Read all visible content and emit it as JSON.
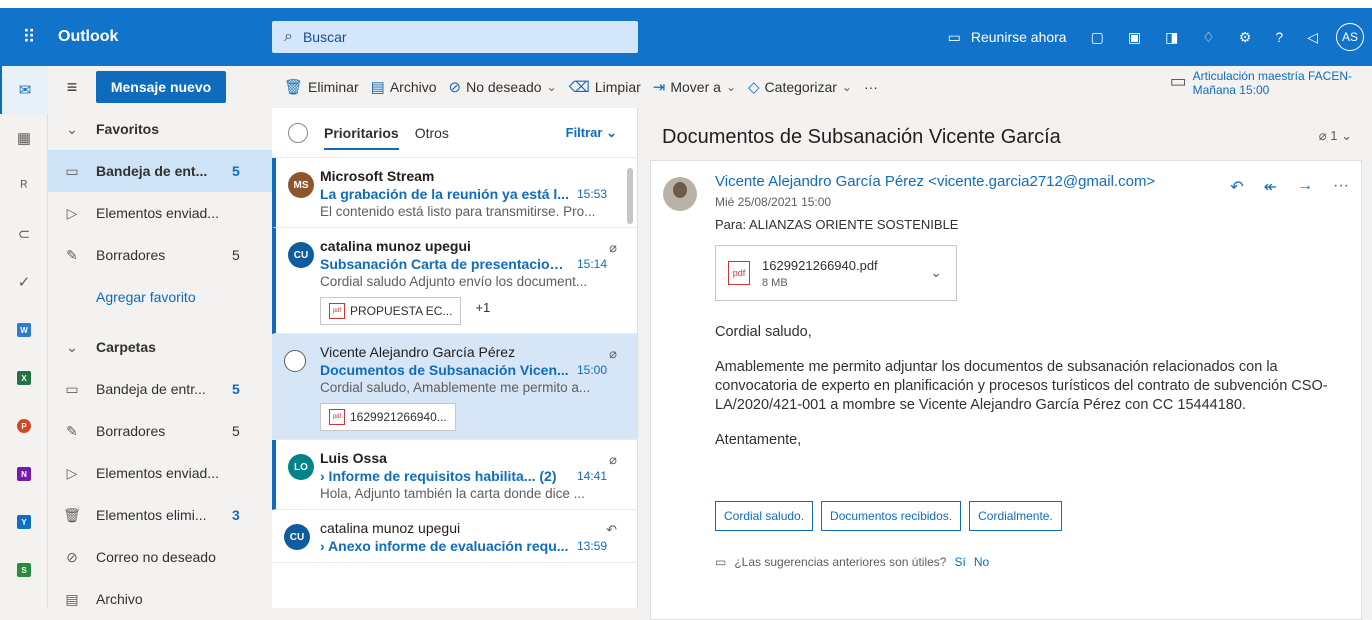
{
  "header": {
    "app_name": "Outlook",
    "search_placeholder": "Buscar",
    "meet_now": "Reunirse ahora",
    "avatar_initials": "AS",
    "help": "?"
  },
  "nav": {
    "new_mail": "Mensaje nuevo",
    "favorites": "Favoritos",
    "favorite_items": [
      {
        "label": "Bandeja de ent...",
        "count": "5"
      },
      {
        "label": "Elementos enviad...",
        "count": ""
      },
      {
        "label": "Borradores",
        "count": "5"
      }
    ],
    "add_favorite": "Agregar favorito",
    "folders": "Carpetas",
    "folder_items": [
      {
        "label": "Bandeja de entr...",
        "count": "5"
      },
      {
        "label": "Borradores",
        "count": "5"
      },
      {
        "label": "Elementos enviad...",
        "count": ""
      },
      {
        "label": "Elementos elimi...",
        "count": "3"
      },
      {
        "label": "Correo no deseado",
        "count": ""
      },
      {
        "label": "Archivo",
        "count": ""
      }
    ]
  },
  "toolbar": {
    "delete": "Eliminar",
    "archive": "Archivo",
    "junk": "No deseado",
    "sweep": "Limpiar",
    "move": "Mover a",
    "categorize": "Categorizar",
    "more": "···",
    "event_title": "Articulación maestría FACEN-",
    "event_time": "Mañana 15:00"
  },
  "list": {
    "tab_focused": "Prioritarios",
    "tab_other": "Otros",
    "filter": "Filtrar",
    "messages": [
      {
        "initials": "MS",
        "from": "Microsoft Stream",
        "subject": "La grabación de la reunión ya está l...",
        "time": "15:53",
        "preview": "El contenido está listo para transmitirse. Pro..."
      },
      {
        "initials": "CU",
        "from": "catalina munoz upegui",
        "subject": "Subsanación Carta de presentacion ...",
        "time": "15:14",
        "preview": "Cordial saludo Adjunto envío los document...",
        "attachment": "PROPUESTA EC...",
        "extra": "+1"
      },
      {
        "from": "Vicente Alejandro García Pérez",
        "subject": "Documentos de Subsanación Vicen...",
        "time": "15:00",
        "preview": "Cordial saludo, Amablemente me permito a...",
        "attachment": "1629921266940..."
      },
      {
        "initials": "LO",
        "from": "Luis Ossa",
        "subject": "› Informe de requisitos habilita... (2)",
        "time": "14:41",
        "preview": "Hola, Adjunto también la carta donde dice ..."
      },
      {
        "initials": "CU",
        "from": "catalina munoz upegui",
        "subject": "› Anexo informe de evaluación requ...",
        "time": "13:59",
        "preview": ""
      }
    ]
  },
  "reading": {
    "title": "Documentos de Subsanación Vicente García",
    "attachment_count": "1",
    "sender": "Vicente Alejandro García Pérez <vicente.garcia2712@gmail.com>",
    "date": "Mié 25/08/2021 15:00",
    "to": "Para:  ALIANZAS ORIENTE SOSTENIBLE",
    "attachment_name": "1629921266940.pdf",
    "attachment_size": "8 MB",
    "greeting": "Cordial saludo,",
    "body": "Amablemente me permito adjuntar los documentos de subsanación relacionados con la convocatoria de experto en planificación y procesos turísticos del contrato de subvención CSO-LA/2020/421-001 a mombre se Vicente Alejandro García Pérez con CC 15444180.",
    "closing": "Atentamente,",
    "suggestions": [
      "Cordial saludo.",
      "Documentos recibidos.",
      "Cordialmente."
    ],
    "feedback_q": "¿Las sugerencias anteriores son útiles?",
    "feedback_yes": "Sí",
    "feedback_no": "No"
  }
}
